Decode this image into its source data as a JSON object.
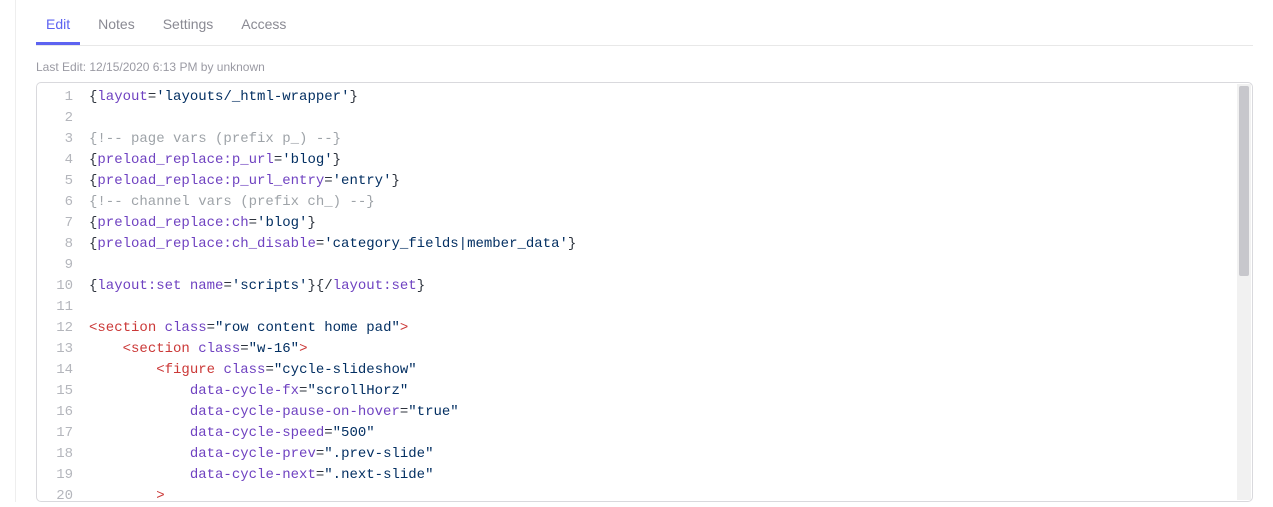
{
  "tabs": {
    "edit": "Edit",
    "notes": "Notes",
    "settings": "Settings",
    "access": "Access"
  },
  "meta": {
    "last_edit": "Last Edit: 12/15/2020 6:13 PM by unknown"
  },
  "code": {
    "l1": {
      "a": "{",
      "b": "layout",
      "c": "=",
      "d": "'layouts/_html-wrapper'",
      "e": "}"
    },
    "l2": "",
    "l3": "{!-- page vars (prefix p_) --}",
    "l4": {
      "a": "{",
      "b": "preload_replace:p_url",
      "c": "=",
      "d": "'blog'",
      "e": "}"
    },
    "l5": {
      "a": "{",
      "b": "preload_replace:p_url_entry",
      "c": "=",
      "d": "'entry'",
      "e": "}"
    },
    "l6": "{!-- channel vars (prefix ch_) --}",
    "l7": {
      "a": "{",
      "b": "preload_replace:ch",
      "c": "=",
      "d": "'blog'",
      "e": "}"
    },
    "l8": {
      "a": "{",
      "b": "preload_replace:ch_disable",
      "c": "=",
      "d": "'category_fields|member_data'",
      "e": "}"
    },
    "l9": "",
    "l10": {
      "a": "{",
      "b": "layout:set",
      "c": " ",
      "d": "name",
      "e": "=",
      "f": "'scripts'",
      "g": "}{/",
      "h": "layout:set",
      "i": "}"
    },
    "l11": "",
    "l12": {
      "a": "<",
      "b": "section",
      "c": " ",
      "d": "class",
      "e": "=",
      "f": "\"row content home pad\"",
      "g": ">"
    },
    "l13": {
      "a": "    <",
      "b": "section",
      "c": " ",
      "d": "class",
      "e": "=",
      "f": "\"w-16\"",
      "g": ">"
    },
    "l14": {
      "a": "        <",
      "b": "figure",
      "c": " ",
      "d": "class",
      "e": "=",
      "f": "\"cycle-slideshow\""
    },
    "l15": {
      "a": "            ",
      "b": "data-cycle-fx",
      "c": "=",
      "d": "\"scrollHorz\""
    },
    "l16": {
      "a": "            ",
      "b": "data-cycle-pause-on-hover",
      "c": "=",
      "d": "\"true\""
    },
    "l17": {
      "a": "            ",
      "b": "data-cycle-speed",
      "c": "=",
      "d": "\"500\""
    },
    "l18": {
      "a": "            ",
      "b": "data-cycle-prev",
      "c": "=",
      "d": "\".prev-slide\""
    },
    "l19": {
      "a": "            ",
      "b": "data-cycle-next",
      "c": "=",
      "d": "\".next-slide\""
    },
    "l20": "        >"
  },
  "gutter": {
    "n1": "1",
    "n2": "2",
    "n3": "3",
    "n4": "4",
    "n5": "5",
    "n6": "6",
    "n7": "7",
    "n8": "8",
    "n9": "9",
    "n10": "10",
    "n11": "11",
    "n12": "12",
    "n13": "13",
    "n14": "14",
    "n15": "15",
    "n16": "16",
    "n17": "17",
    "n18": "18",
    "n19": "19",
    "n20": "20"
  }
}
